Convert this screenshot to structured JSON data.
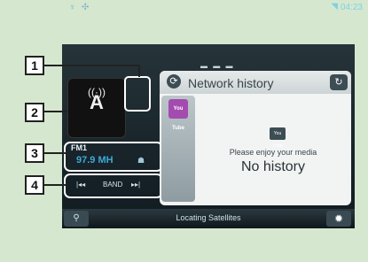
{
  "status_bar": {
    "time": "04:23",
    "left_icons": [
      "antenna-icon",
      "settings-icon"
    ]
  },
  "tuner": {
    "icon_letter": "A",
    "band": "FM1",
    "frequency": "97.9 MH"
  },
  "controls": {
    "prev": "|◂◂",
    "band": "BAND",
    "next": "▸▸|"
  },
  "panel": {
    "title": "Network history",
    "tab_label": "You Tube",
    "logo_text": "You Tube",
    "message": "Please enjoy your media",
    "empty_text": "No history"
  },
  "bottom": {
    "status": "Locating Satellites"
  },
  "callouts": [
    "1",
    "2",
    "3",
    "4"
  ]
}
